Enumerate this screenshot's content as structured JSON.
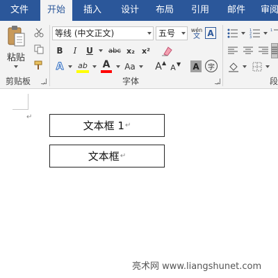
{
  "tabs": [
    {
      "label": "文件",
      "active": false
    },
    {
      "label": "开始",
      "active": true
    },
    {
      "label": "插入",
      "active": false
    },
    {
      "label": "设计",
      "active": false
    },
    {
      "label": "布局",
      "active": false
    },
    {
      "label": "引用",
      "active": false
    },
    {
      "label": "邮件",
      "active": false
    },
    {
      "label": "审阅",
      "active": false
    }
  ],
  "clipboard": {
    "paste_label": "粘贴",
    "group_label": "剪贴板"
  },
  "font": {
    "font_name": "等线 (中文正文)",
    "font_size": "五号",
    "wen_top": "wén",
    "wen_bottom": "文",
    "border_char": "A",
    "bold": "B",
    "italic": "I",
    "underline": "U",
    "strike": "abc",
    "subscript": "x₂",
    "superscript": "x²",
    "text_effect": "A",
    "highlight": "ab",
    "font_color": "A",
    "change_case": "Aa",
    "grow_font": "A",
    "shrink_font": "A",
    "char_shading": "A",
    "enclose_char": "字",
    "group_label": "字体"
  },
  "paragraph": {
    "group_label": "段"
  },
  "colors": {
    "brand": "#2b579a",
    "highlight_yellow": "#ffff00",
    "font_red": "#ff0000"
  },
  "document": {
    "textbox1": "文本框 1",
    "textbox2": "文本框",
    "para_mark": "↵"
  },
  "watermark": "亮术网 www.liangshunet.com"
}
